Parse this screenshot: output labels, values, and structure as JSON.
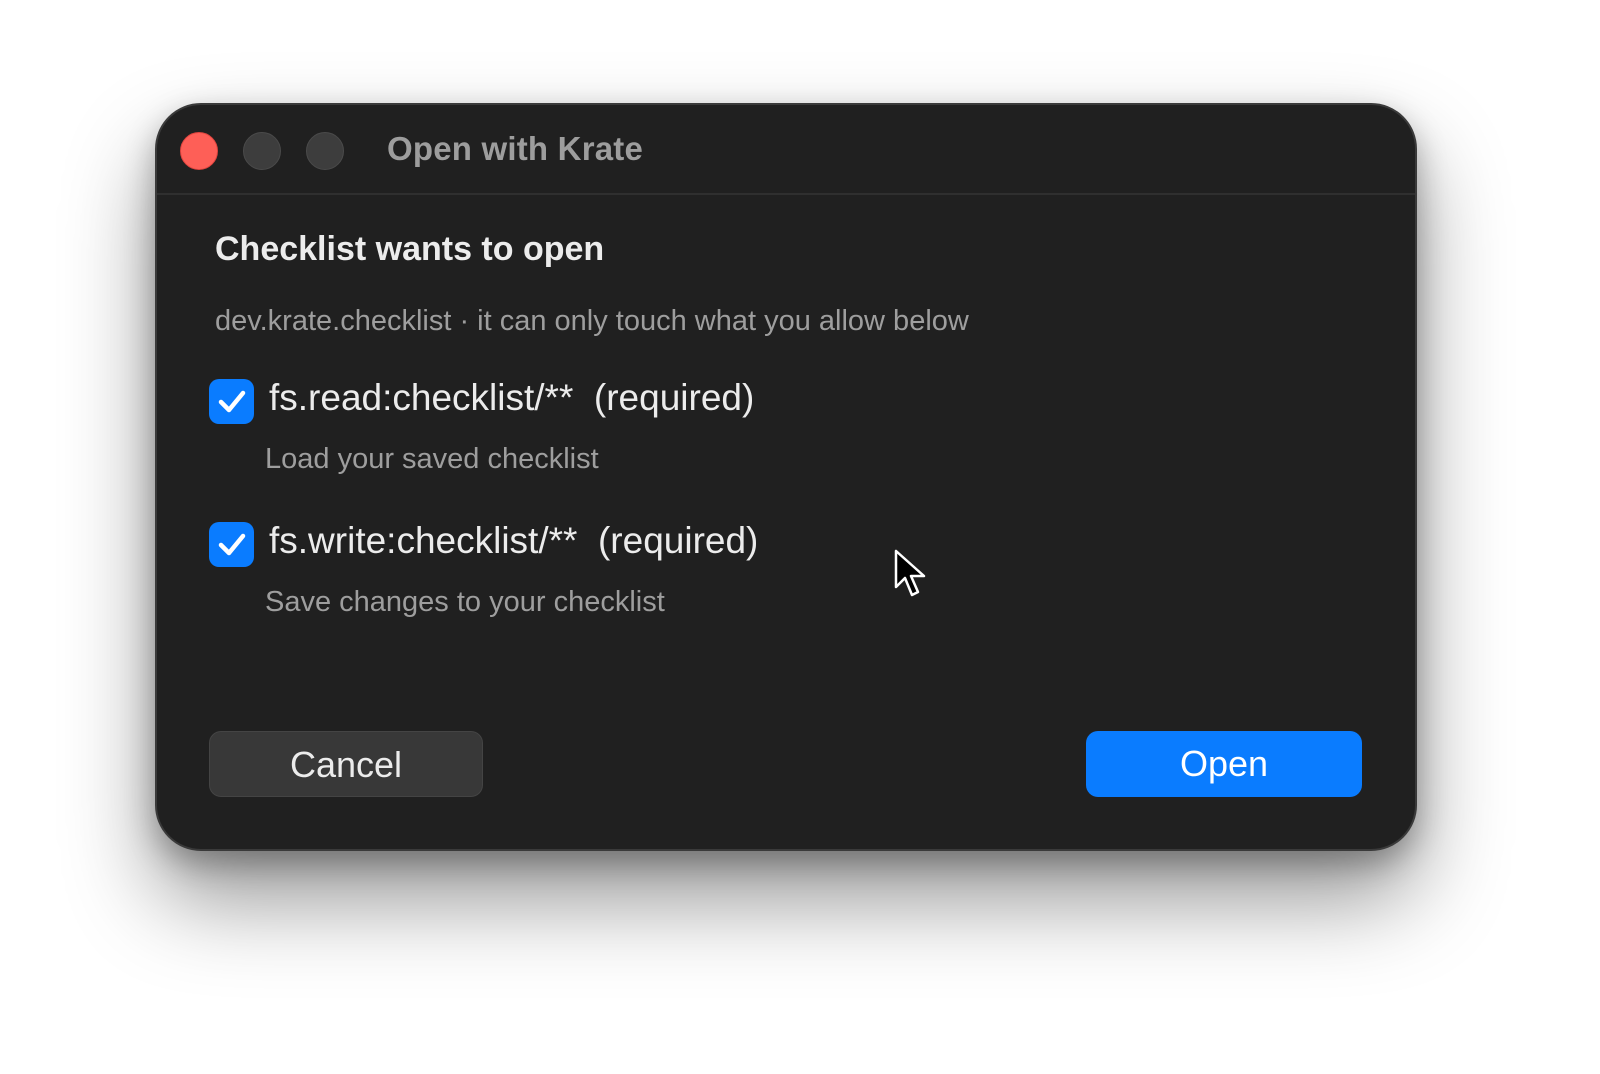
{
  "window": {
    "title": "Open with Krate"
  },
  "dialog": {
    "heading": "Checklist wants to open",
    "subtext": "dev.krate.checklist · it can only touch what you allow below",
    "permissions": [
      {
        "label": "fs.read:checklist/**  (required)",
        "description": "Load your saved checklist",
        "checked": true
      },
      {
        "label": "fs.write:checklist/**  (required)",
        "description": "Save changes to your checklist",
        "checked": true
      }
    ]
  },
  "buttons": {
    "cancel_label": "Cancel",
    "open_label": "Open"
  },
  "colors": {
    "accent": "#0a7cff",
    "close": "#fe5f57",
    "window_bg": "#202020"
  },
  "icons": {
    "close": "close-traffic-light",
    "minimize": "minimize-traffic-light",
    "zoom": "zoom-traffic-light",
    "check": "checkmark-icon",
    "cursor": "mouse-pointer-icon"
  }
}
